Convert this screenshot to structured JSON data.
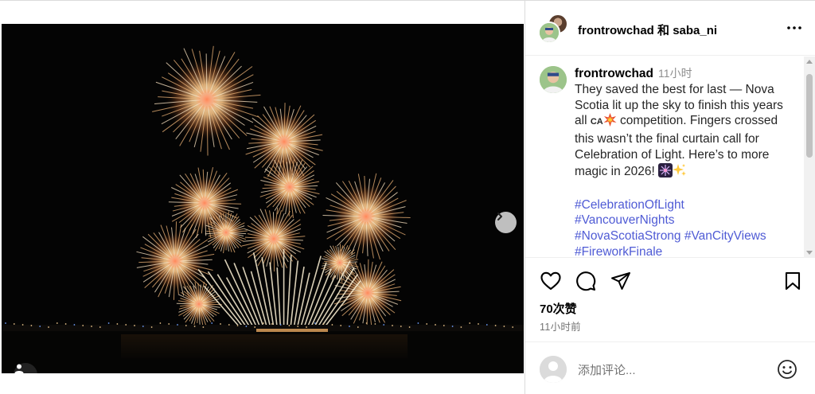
{
  "post": {
    "header_user1": "frontrowchad",
    "header_joiner": "和",
    "header_user2": "saba_ni",
    "caption_user": "frontrowchad",
    "caption_time": "11小时",
    "caption_text_1": "They saved the best for last — Nova Scotia lit up the sky to finish this years all ",
    "caption_flag": "CA",
    "caption_text_2": " competition. Fingers crossed this wasn’t the final curtain call for Celebration of Light. Here’s to more magic in 2026! ",
    "hashtags": [
      "#CelebrationOfLight",
      "#VancouverNights",
      "#NovaScotiaStrong",
      "#VanCityViews",
      "#FireworkFinale"
    ],
    "likes": "70次赞",
    "ago": "11小时前"
  },
  "comment": {
    "placeholder": "添加评论..."
  },
  "carousel": {
    "slide_count": 10,
    "active_index": 0
  },
  "icons": {
    "more": "more-horizontal-icon",
    "like": "heart-icon",
    "comment": "comment-icon",
    "share": "send-icon",
    "save": "bookmark-icon",
    "next": "chevron-right-icon",
    "tag": "user-tag-icon",
    "emoji": "smiley-icon"
  },
  "colors": {
    "hashtag": "#4f5bd5",
    "muted": "#737373",
    "border": "#dbdbdb"
  }
}
